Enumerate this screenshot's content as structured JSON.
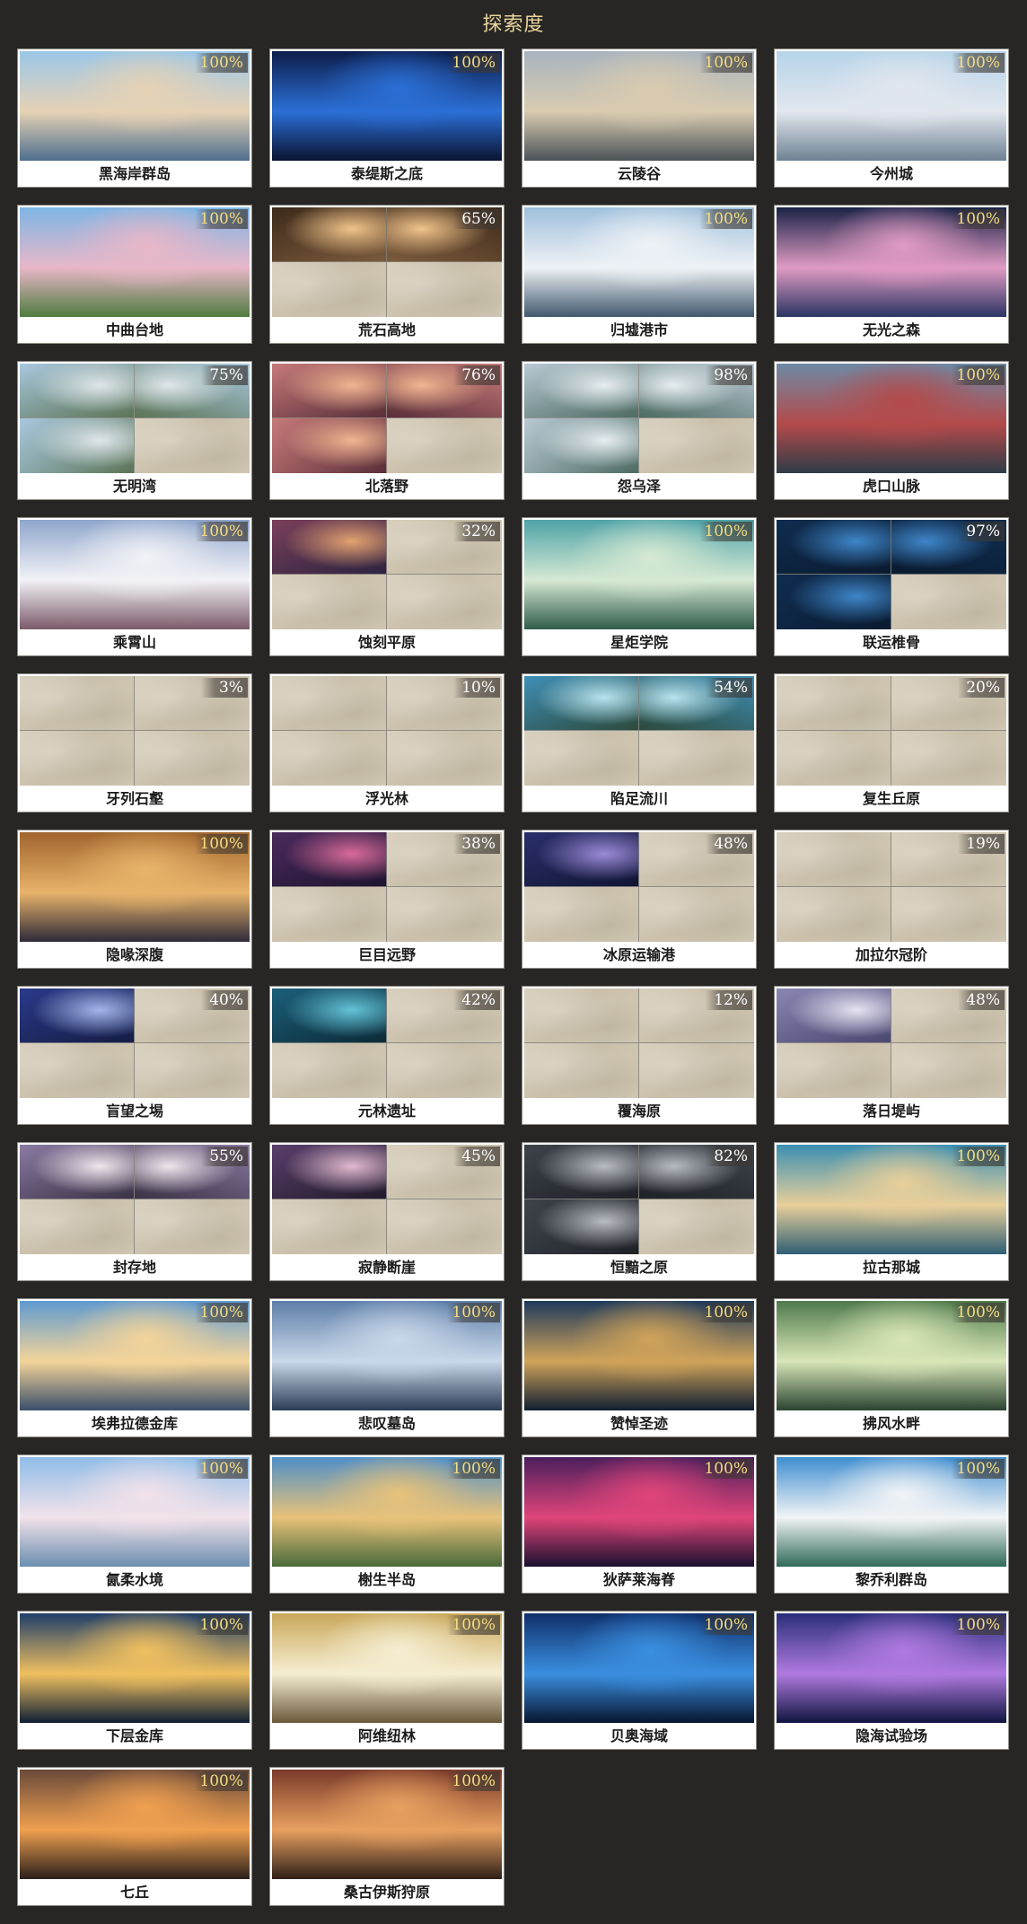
{
  "page": {
    "title": "探索度"
  },
  "colors": {
    "background": "#272624",
    "title": "#e9d59c",
    "badge_complete": "#f4dd82",
    "badge_partial": "#ffffff",
    "unexplored_map": "#d2c9b6"
  },
  "regions": [
    {
      "name": "黑海岸群岛",
      "progress": "100%",
      "revealed": [
        1,
        1,
        1,
        1
      ],
      "palette": [
        "#9bc7e8",
        "#e6d2b5",
        "#4e6f8e"
      ]
    },
    {
      "name": "泰缇斯之底",
      "progress": "100%",
      "revealed": [
        1,
        1,
        1,
        1
      ],
      "palette": [
        "#0d1d4a",
        "#2b6fd6",
        "#0a1330"
      ]
    },
    {
      "name": "云陵谷",
      "progress": "100%",
      "revealed": [
        1,
        1,
        1,
        1
      ],
      "palette": [
        "#a8b4bf",
        "#d9cbb0",
        "#4b5258"
      ]
    },
    {
      "name": "今州城",
      "progress": "100%",
      "revealed": [
        1,
        1,
        1,
        1
      ],
      "palette": [
        "#b7d4ea",
        "#e2e7ee",
        "#6e8294"
      ]
    },
    {
      "name": "中曲台地",
      "progress": "100%",
      "revealed": [
        1,
        1,
        1,
        1
      ],
      "palette": [
        "#7eb6e6",
        "#e8b7c8",
        "#4f7b3f"
      ]
    },
    {
      "name": "荒石高地",
      "progress": "65%",
      "revealed": [
        1,
        1,
        0,
        0
      ],
      "palette": [
        "#3d2a1a",
        "#f0c38a",
        "#7b5a3c"
      ]
    },
    {
      "name": "归墟港市",
      "progress": "100%",
      "revealed": [
        1,
        1,
        1,
        1
      ],
      "palette": [
        "#9fc0dc",
        "#eef2f6",
        "#41586c"
      ]
    },
    {
      "name": "无光之森",
      "progress": "100%",
      "revealed": [
        1,
        1,
        1,
        1
      ],
      "palette": [
        "#1a2347",
        "#e09bc4",
        "#2b3563"
      ]
    },
    {
      "name": "无明湾",
      "progress": "75%",
      "revealed": [
        1,
        1,
        1,
        0
      ],
      "palette": [
        "#a9c8de",
        "#dfe6ea",
        "#5b7456"
      ]
    },
    {
      "name": "北落野",
      "progress": "76%",
      "revealed": [
        1,
        1,
        1,
        0
      ],
      "palette": [
        "#c77a7a",
        "#f0b58f",
        "#5a2f3a"
      ]
    },
    {
      "name": "怨乌泽",
      "progress": "98%",
      "revealed": [
        1,
        1,
        1,
        0
      ],
      "palette": [
        "#b9c9d4",
        "#e6edf0",
        "#4d6b63"
      ]
    },
    {
      "name": "虎口山脉",
      "progress": "100%",
      "revealed": [
        1,
        1,
        1,
        1
      ],
      "palette": [
        "#6d8aa6",
        "#b44a4a",
        "#2e3c47"
      ]
    },
    {
      "name": "乘霄山",
      "progress": "100%",
      "revealed": [
        1,
        1,
        1,
        1
      ],
      "palette": [
        "#8fa6cc",
        "#f2f2f6",
        "#7b5a6a"
      ]
    },
    {
      "name": "蚀刻平原",
      "progress": "32%",
      "revealed": [
        1,
        0,
        0,
        0
      ],
      "palette": [
        "#7b3f5a",
        "#e2a26f",
        "#2d2440"
      ]
    },
    {
      "name": "星炬学院",
      "progress": "100%",
      "revealed": [
        1,
        1,
        1,
        1
      ],
      "palette": [
        "#4fa3a8",
        "#d6e9d3",
        "#2f5c4a"
      ]
    },
    {
      "name": "联运椎骨",
      "progress": "97%",
      "revealed": [
        1,
        1,
        1,
        0
      ],
      "palette": [
        "#0f2c4f",
        "#3f86c9",
        "#0a1b30"
      ]
    },
    {
      "name": "牙列石壑",
      "progress": "3%",
      "revealed": [
        0,
        0,
        0,
        0
      ],
      "palette": [
        "#d2c9b6",
        "#d2c9b6",
        "#d2c9b6"
      ]
    },
    {
      "name": "浮光林",
      "progress": "10%",
      "revealed": [
        0,
        0,
        0,
        0
      ],
      "palette": [
        "#d2c9b6",
        "#d2c9b6",
        "#d2c9b6"
      ]
    },
    {
      "name": "陷足流川",
      "progress": "54%",
      "revealed": [
        1,
        1,
        0,
        0
      ],
      "palette": [
        "#3f8fb6",
        "#b7e3ef",
        "#2c4a3c"
      ]
    },
    {
      "name": "复生丘原",
      "progress": "20%",
      "revealed": [
        0,
        0,
        0,
        0
      ],
      "palette": [
        "#d2c9b6",
        "#d2c9b6",
        "#d2c9b6"
      ]
    },
    {
      "name": "隐喙深腹",
      "progress": "100%",
      "revealed": [
        1,
        1,
        1,
        1
      ],
      "palette": [
        "#a0642c",
        "#e8b36b",
        "#2e2a38"
      ]
    },
    {
      "name": "巨目远野",
      "progress": "38%",
      "revealed": [
        1,
        0,
        0,
        0
      ],
      "palette": [
        "#4b2a5c",
        "#d96a9a",
        "#1e1530"
      ]
    },
    {
      "name": "冰原运输港",
      "progress": "48%",
      "revealed": [
        1,
        0,
        0,
        0
      ],
      "palette": [
        "#2a2f6b",
        "#9b8ad8",
        "#111533"
      ]
    },
    {
      "name": "加拉尔冠阶",
      "progress": "19%",
      "revealed": [
        0,
        0,
        0,
        0
      ],
      "palette": [
        "#d2c9b6",
        "#d2c9b6",
        "#d2c9b6"
      ]
    },
    {
      "name": "盲望之埸",
      "progress": "40%",
      "revealed": [
        1,
        0,
        0,
        0
      ],
      "palette": [
        "#2a3a8a",
        "#a3b6ea",
        "#151d45"
      ]
    },
    {
      "name": "元林遗址",
      "progress": "42%",
      "revealed": [
        1,
        0,
        0,
        0
      ],
      "palette": [
        "#1b5f7a",
        "#63c2d6",
        "#0d2b38"
      ]
    },
    {
      "name": "覆海原",
      "progress": "12%",
      "revealed": [
        0,
        0,
        0,
        0
      ],
      "palette": [
        "#d2c9b6",
        "#d2c9b6",
        "#d2c9b6"
      ]
    },
    {
      "name": "落日堤屿",
      "progress": "48%",
      "revealed": [
        1,
        0,
        0,
        0
      ],
      "palette": [
        "#8a87b3",
        "#e6e3f2",
        "#4a4870"
      ]
    },
    {
      "name": "封存地",
      "progress": "55%",
      "revealed": [
        1,
        1,
        0,
        0
      ],
      "palette": [
        "#8b7aa3",
        "#f0e6ec",
        "#3a3346"
      ]
    },
    {
      "name": "寂静断崖",
      "progress": "45%",
      "revealed": [
        1,
        0,
        0,
        0
      ],
      "palette": [
        "#5a3f6c",
        "#e0b9cf",
        "#221b2c"
      ]
    },
    {
      "name": "恒黯之原",
      "progress": "82%",
      "revealed": [
        1,
        1,
        1,
        0
      ],
      "palette": [
        "#3e434b",
        "#b8bcc2",
        "#1f2227"
      ]
    },
    {
      "name": "拉古那城",
      "progress": "100%",
      "revealed": [
        1,
        1,
        1,
        1
      ],
      "palette": [
        "#3a8fb2",
        "#e8cf9a",
        "#2f5f74"
      ]
    },
    {
      "name": "埃弗拉德金库",
      "progress": "100%",
      "revealed": [
        1,
        1,
        1,
        1
      ],
      "palette": [
        "#5f9ad0",
        "#f4d49a",
        "#3a4f6a"
      ]
    },
    {
      "name": "悲叹墓岛",
      "progress": "100%",
      "revealed": [
        1,
        1,
        1,
        1
      ],
      "palette": [
        "#5d7ea8",
        "#c9d8ea",
        "#2b3c56"
      ]
    },
    {
      "name": "赞悼圣迹",
      "progress": "100%",
      "revealed": [
        1,
        1,
        1,
        1
      ],
      "palette": [
        "#1e3a5c",
        "#d0a35a",
        "#0f1e30"
      ]
    },
    {
      "name": "拂风水畔",
      "progress": "100%",
      "revealed": [
        1,
        1,
        1,
        1
      ],
      "palette": [
        "#4f7a4a",
        "#d8e6b8",
        "#2a4430"
      ]
    },
    {
      "name": "氤柔水境",
      "progress": "100%",
      "revealed": [
        1,
        1,
        1,
        1
      ],
      "palette": [
        "#8fbde8",
        "#f2e2ea",
        "#6b8fb0"
      ]
    },
    {
      "name": "榭生半岛",
      "progress": "100%",
      "revealed": [
        1,
        1,
        1,
        1
      ],
      "palette": [
        "#4f8fc8",
        "#e8c27a",
        "#4a6a3a"
      ]
    },
    {
      "name": "狄萨莱海脊",
      "progress": "100%",
      "revealed": [
        1,
        1,
        1,
        1
      ],
      "palette": [
        "#4a1f5c",
        "#e0457a",
        "#1a1030"
      ]
    },
    {
      "name": "黎乔利群岛",
      "progress": "100%",
      "revealed": [
        1,
        1,
        1,
        1
      ],
      "palette": [
        "#3f8ed0",
        "#f2f4f6",
        "#2f6a5a"
      ]
    },
    {
      "name": "下层金库",
      "progress": "100%",
      "revealed": [
        1,
        1,
        1,
        1
      ],
      "palette": [
        "#1f3f6a",
        "#f0c060",
        "#0f1f35"
      ]
    },
    {
      "name": "阿维纽林",
      "progress": "100%",
      "revealed": [
        1,
        1,
        1,
        1
      ],
      "palette": [
        "#c9a85a",
        "#f6eed2",
        "#6a5a3a"
      ]
    },
    {
      "name": "贝奥海域",
      "progress": "100%",
      "revealed": [
        1,
        1,
        1,
        1
      ],
      "palette": [
        "#0f2f6a",
        "#3a8fe0",
        "#081530"
      ]
    },
    {
      "name": "隐海试验场",
      "progress": "100%",
      "revealed": [
        1,
        1,
        1,
        1
      ],
      "palette": [
        "#2a2f7a",
        "#b07ae0",
        "#101540"
      ]
    },
    {
      "name": "七丘",
      "progress": "100%",
      "revealed": [
        1,
        1,
        1,
        1
      ],
      "palette": [
        "#6a4a3a",
        "#f0a050",
        "#2a1f1a"
      ]
    },
    {
      "name": "桑古伊斯狩原",
      "progress": "100%",
      "revealed": [
        1,
        1,
        1,
        1
      ],
      "palette": [
        "#7a3a2a",
        "#e8a060",
        "#2f1f18"
      ]
    }
  ]
}
